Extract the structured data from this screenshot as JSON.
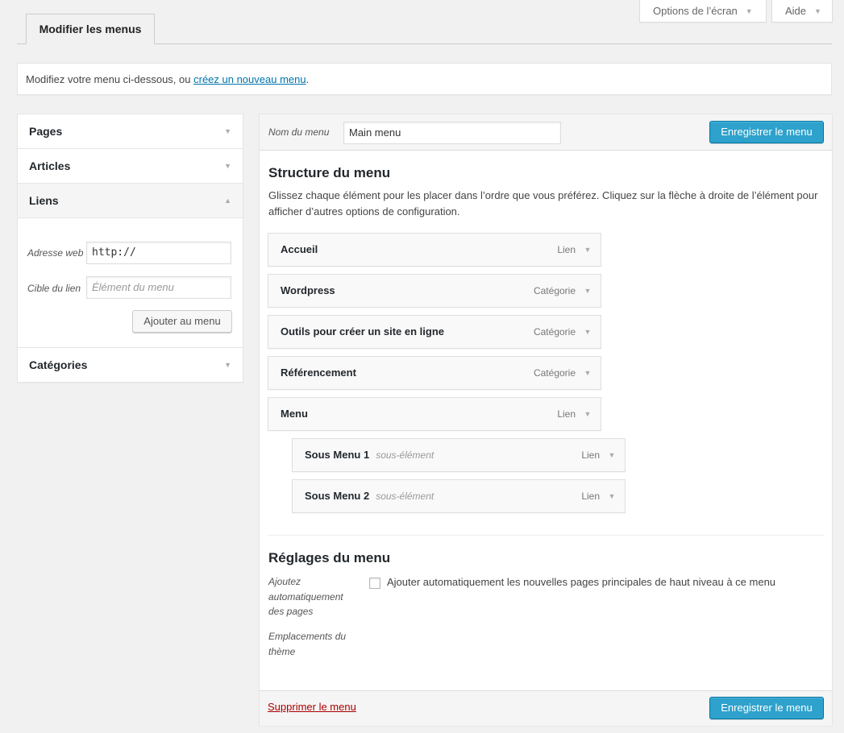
{
  "screen_meta": {
    "options_label": "Options de l’écran",
    "help_label": "Aide"
  },
  "tab": {
    "label": "Modifier les menus"
  },
  "notice": {
    "text": "Modifiez votre menu ci-dessous, ou ",
    "link": "créez un nouveau menu",
    "end": "."
  },
  "accordion": {
    "sections": [
      "Pages",
      "Articles",
      "Liens",
      "Catégories"
    ],
    "links": {
      "url_label": "Adresse web",
      "url_value": "http://",
      "target_label": "Cible du lien",
      "target_placeholder": "Élément du menu",
      "add_button": "Ajouter au menu"
    }
  },
  "menu_header": {
    "name_label": "Nom du menu",
    "name_value": "Main menu",
    "save_button": "Enregistrer le menu"
  },
  "structure": {
    "title": "Structure du menu",
    "description": "Glissez chaque élément pour les placer dans l’ordre que vous préférez. Cliquez sur la flèche à droite de l’élément pour afficher d’autres options de configuration.",
    "items": [
      {
        "title": "Accueil",
        "type": "Lien",
        "sub": ""
      },
      {
        "title": "Wordpress",
        "type": "Catégorie",
        "sub": ""
      },
      {
        "title": "Outils pour créer un site en ligne",
        "type": "Catégorie",
        "sub": ""
      },
      {
        "title": "Référencement",
        "type": "Catégorie",
        "sub": ""
      },
      {
        "title": "Menu",
        "type": "Lien",
        "sub": ""
      },
      {
        "title": "Sous Menu 1",
        "type": "Lien",
        "sub": "sous-élément"
      },
      {
        "title": "Sous Menu 2",
        "type": "Lien",
        "sub": "sous-élément"
      }
    ]
  },
  "settings": {
    "title": "Réglages du menu",
    "auto_add_label": "Ajoutez automatiquement des pages",
    "auto_add_checkbox": "Ajouter automatiquement les nouvelles pages principales de haut niveau à ce menu",
    "locations_label": "Emplacements du thème"
  },
  "footer": {
    "delete_link": "Supprimer le menu",
    "save_button": "Enregistrer le menu"
  },
  "colors": {
    "primary": "#2ea2cc",
    "link": "#0073aa",
    "danger": "#a00"
  }
}
